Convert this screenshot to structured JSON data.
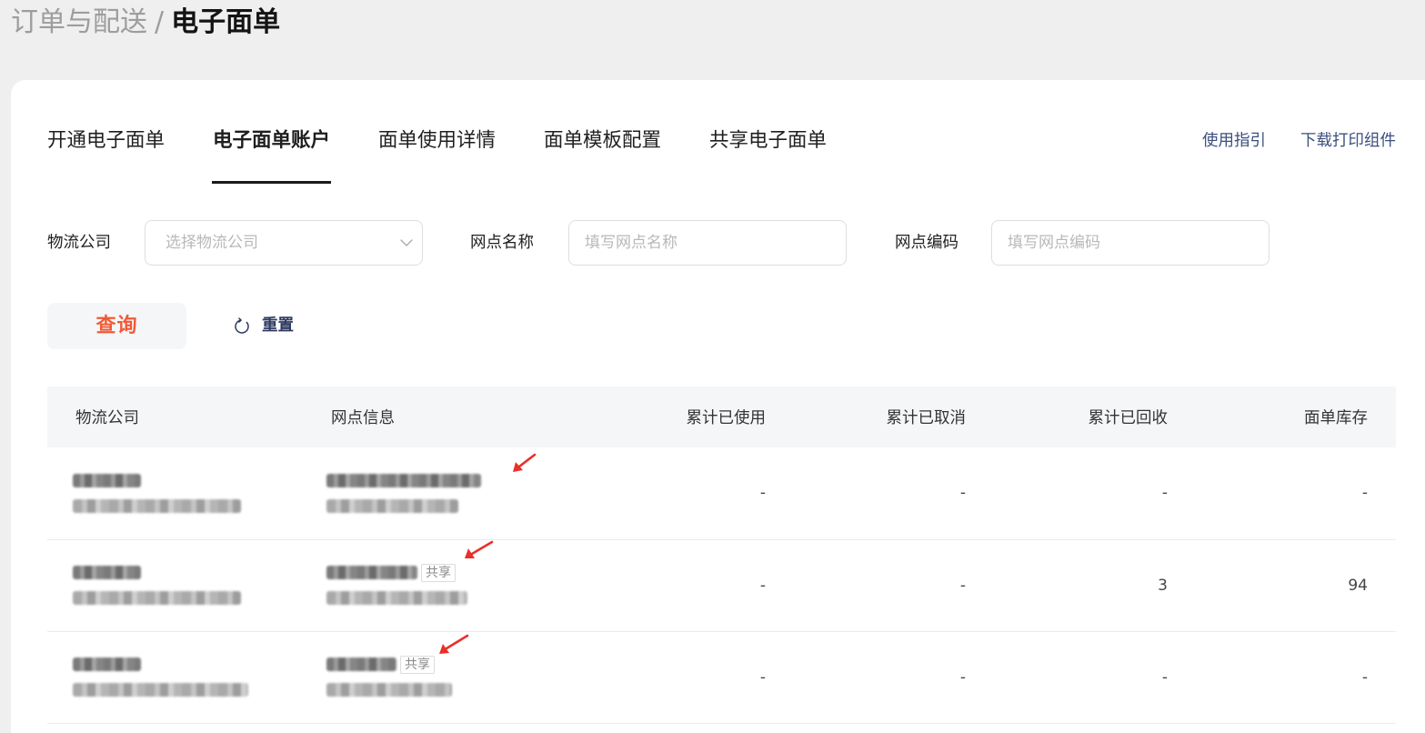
{
  "breadcrumb": {
    "parent": "订单与配送",
    "separator": "/",
    "current": "电子面单"
  },
  "tabs": [
    {
      "label": "开通电子面单",
      "active": false
    },
    {
      "label": "电子面单账户",
      "active": true
    },
    {
      "label": "面单使用详情",
      "active": false
    },
    {
      "label": "面单模板配置",
      "active": false
    },
    {
      "label": "共享电子面单",
      "active": false
    }
  ],
  "header_links": {
    "guide": "使用指引",
    "download_print_component": "下载打印组件"
  },
  "filters": {
    "logistics_company": {
      "label": "物流公司",
      "placeholder": "选择物流公司",
      "value": ""
    },
    "branch_name": {
      "label": "网点名称",
      "placeholder": "填写网点名称",
      "value": ""
    },
    "branch_code": {
      "label": "网点编码",
      "placeholder": "填写网点编码",
      "value": ""
    }
  },
  "actions": {
    "query": "查询",
    "reset": "重置"
  },
  "table": {
    "columns": [
      "物流公司",
      "网点信息",
      "累计已使用",
      "累计已取消",
      "累计已回收",
      "面单库存"
    ],
    "rows": [
      {
        "used": "-",
        "cancelled": "-",
        "recycled": "-",
        "stock": "-"
      },
      {
        "tag": "共享",
        "used": "-",
        "cancelled": "-",
        "recycled": "3",
        "stock": "94"
      },
      {
        "tag": "共享",
        "used": "-",
        "cancelled": "-",
        "recycled": "-",
        "stock": "-"
      }
    ]
  },
  "icons": {
    "select_arrow": "chevron-down-icon",
    "reset": "refresh-icon",
    "annotation": "red-arrow-icon"
  },
  "colors": {
    "page_background": "#efefef",
    "card_background": "#ffffff",
    "text": "#1f1f1f",
    "breadcrumb_parent": "#9d9d9d",
    "link": "#3c4f7e",
    "accent": "#f15a36",
    "soft_background": "#f5f6f8",
    "reset_text": "#2d3a60",
    "input_border": "#dedede",
    "row_border": "#ebebeb",
    "placeholder": "#b8b8b8",
    "tag_text": "#8a8a8a",
    "annotation_arrow": "#e8302a"
  }
}
